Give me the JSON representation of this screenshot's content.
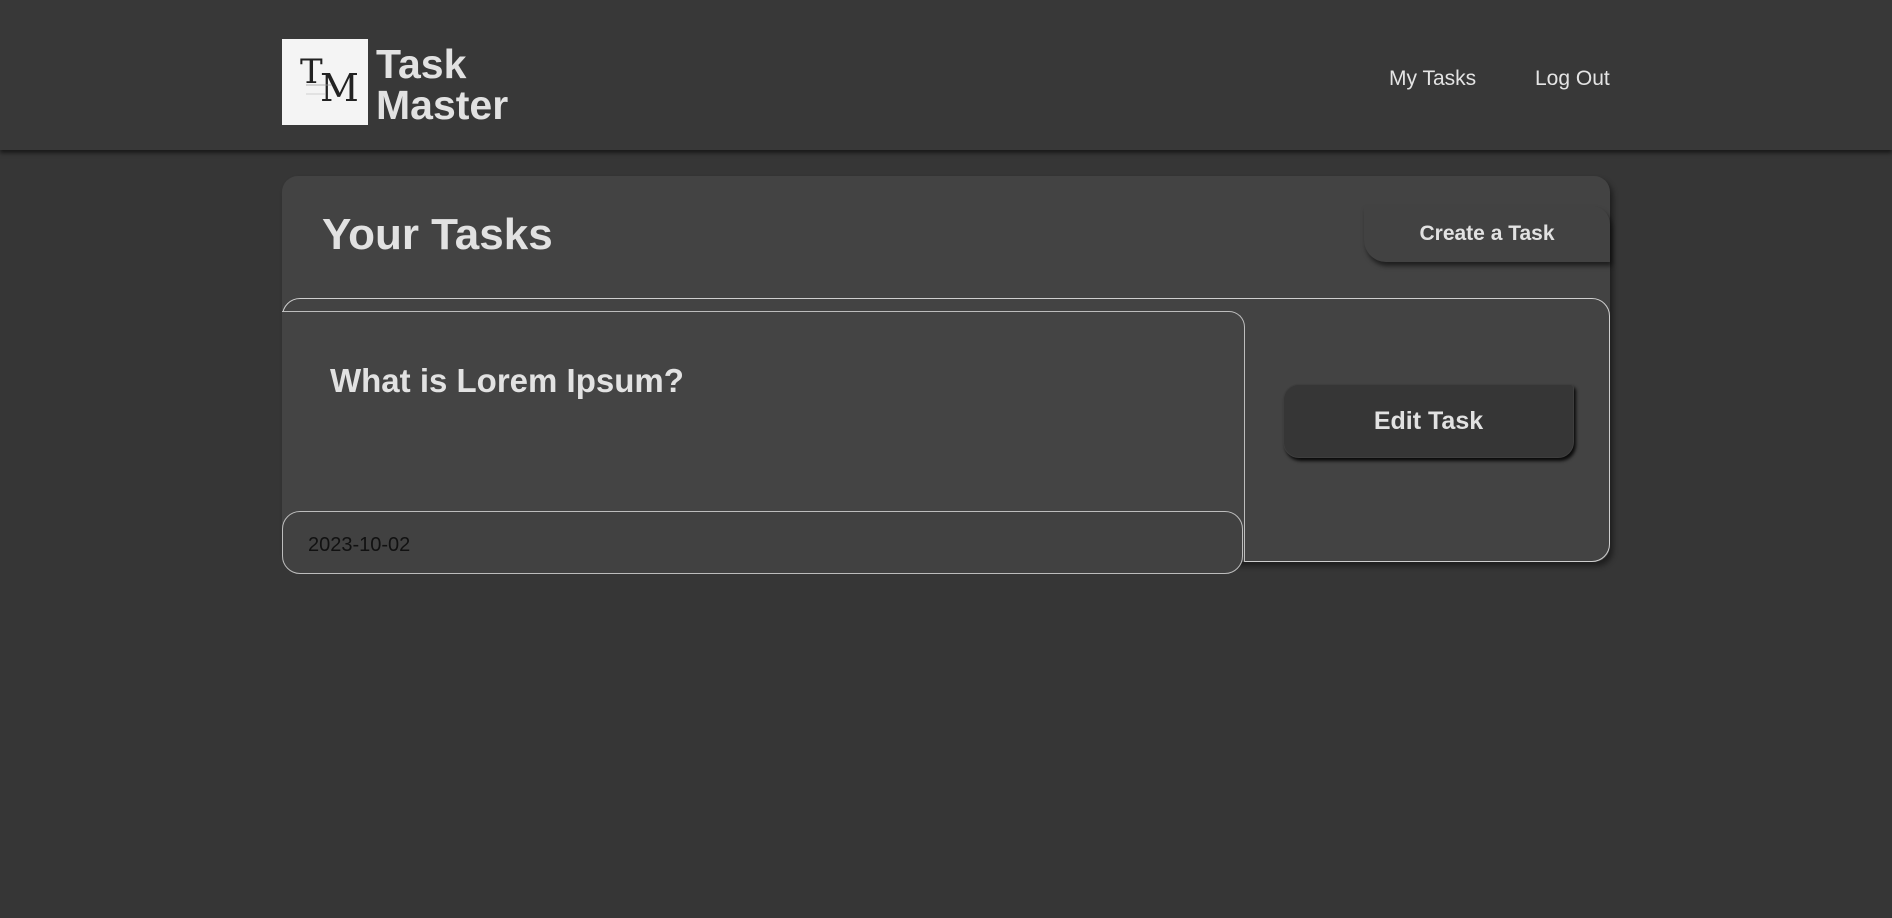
{
  "header": {
    "brand_line1": "Task",
    "brand_line2": "Master",
    "nav": {
      "my_tasks": "My Tasks",
      "log_out": "Log Out"
    }
  },
  "main": {
    "title": "Your Tasks",
    "create_button": "Create a Task",
    "tasks": [
      {
        "title": "What is Lorem Ipsum?",
        "date": "2023-10-02",
        "edit_button": "Edit Task"
      }
    ]
  },
  "colors": {
    "background": "#363636",
    "header": "#383838",
    "panel": "#434343",
    "text": "#e2e2e2"
  }
}
